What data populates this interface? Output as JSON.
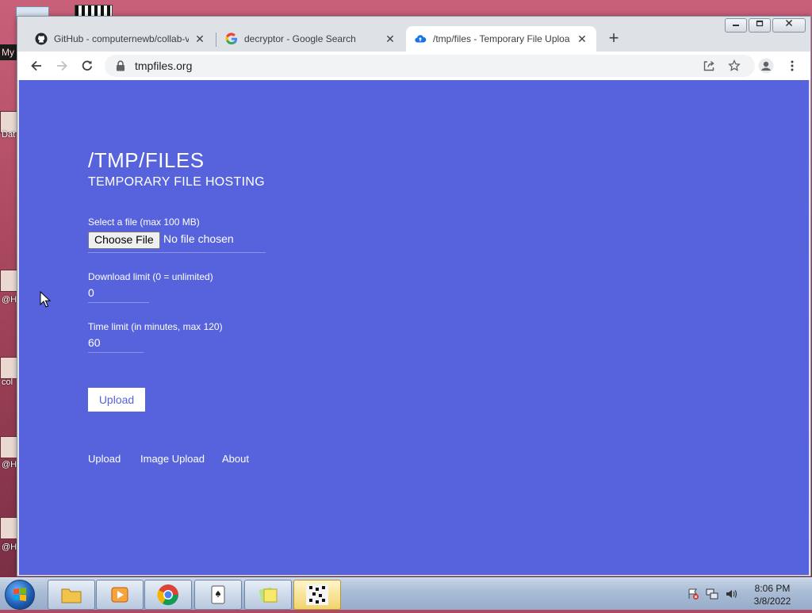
{
  "browser": {
    "tabs": [
      {
        "title": "GitHub - computernewb/collab-v",
        "close": "✕"
      },
      {
        "title": "decryptor - Google Search",
        "close": "✕"
      },
      {
        "title": "/tmp/files - Temporary File Uploa",
        "close": "✕"
      }
    ],
    "new_tab": "+",
    "address": "tmpfiles.org"
  },
  "page": {
    "title": "/TMP/FILES",
    "subtitle": "TEMPORARY FILE HOSTING",
    "file_label": "Select a file (max 100 MB)",
    "choose_file": "Choose File",
    "no_file": "No file chosen",
    "download_label": "Download limit (0 = unlimited)",
    "download_value": "0",
    "time_label": "Time limit (in minutes, max 120)",
    "time_value": "60",
    "upload_button": "Upload",
    "footer": [
      "Upload",
      "Image Upload",
      "About"
    ]
  },
  "desktop": {
    "labels": [
      "My",
      "Dat",
      "@H",
      "col",
      "@H",
      "@H"
    ]
  },
  "taskbar": {
    "time": "8:06 PM",
    "date": "3/8/2022"
  },
  "colors": {
    "page_bg": "#5763dc",
    "tab_bg": "#dee1e6"
  }
}
